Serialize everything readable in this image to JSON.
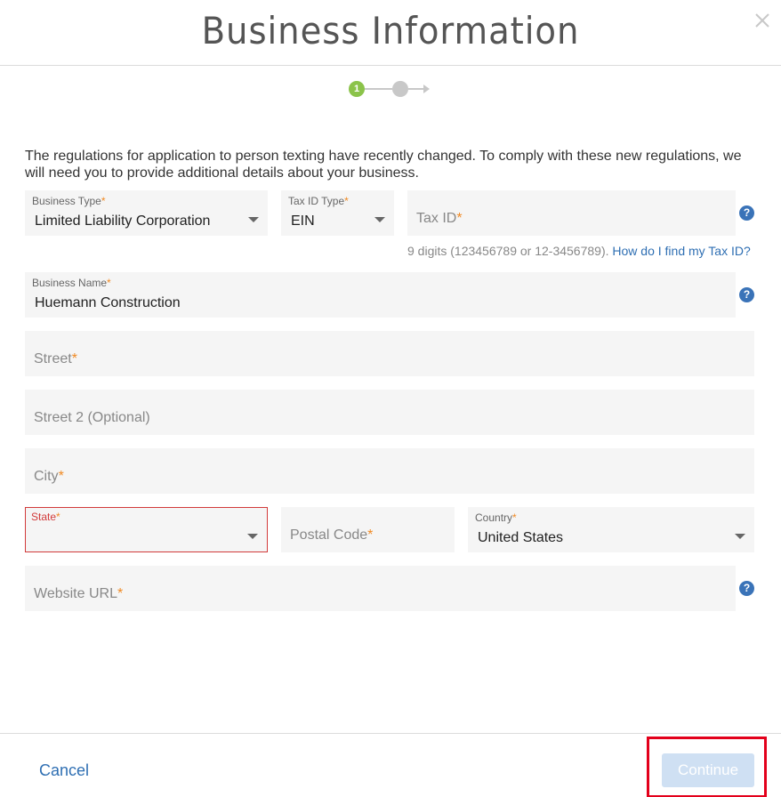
{
  "header": {
    "title": "Business Information"
  },
  "stepper": {
    "current_step": "1"
  },
  "intro_text": "The regulations for application to person texting have recently changed. To comply with these new regulations, we will need you to provide additional details about your business.",
  "form": {
    "business_type": {
      "label": "Business Type",
      "value": "Limited Liability Corporation"
    },
    "tax_id_type": {
      "label": "Tax ID Type",
      "value": "EIN"
    },
    "tax_id": {
      "placeholder": "Tax ID"
    },
    "tax_id_hint": "9 digits (123456789 or 12-3456789).",
    "tax_id_help_link": "How do I find my Tax ID?",
    "business_name": {
      "label": "Business Name",
      "value": "Huemann Construction"
    },
    "street": {
      "placeholder": "Street"
    },
    "street2": {
      "placeholder": "Street 2 (Optional)"
    },
    "city": {
      "placeholder": "City"
    },
    "state": {
      "label": "State",
      "value": ""
    },
    "postal_code": {
      "placeholder": "Postal Code"
    },
    "country": {
      "label": "Country",
      "value": "United States"
    },
    "website_url": {
      "placeholder": "Website URL"
    },
    "required_mark": "*",
    "help_glyph": "?"
  },
  "footer": {
    "cancel_label": "Cancel",
    "continue_label": "Continue"
  },
  "colors": {
    "accent": "#2f6fb3",
    "step_active": "#8bc34a",
    "required": "#f08a24",
    "error": "#d23b3b",
    "highlight": "#e3001b"
  }
}
